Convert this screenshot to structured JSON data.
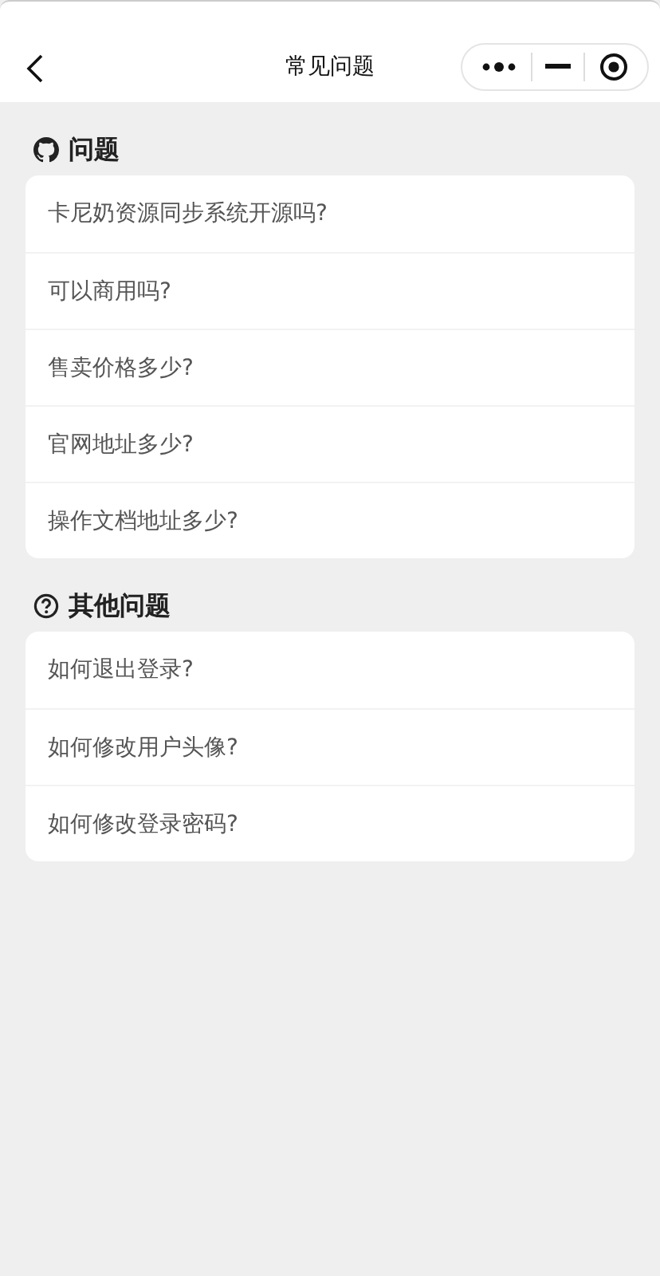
{
  "nav": {
    "title": "常见问题"
  },
  "sections": [
    {
      "title": "问题",
      "items": [
        "卡尼奶资源同步系统开源吗?",
        "可以商用吗?",
        "售卖价格多少?",
        "官网地址多少?",
        "操作文档地址多少?"
      ]
    },
    {
      "title": "其他问题",
      "items": [
        "如何退出登录?",
        "如何修改用户头像?",
        "如何修改登录密码?"
      ]
    }
  ]
}
